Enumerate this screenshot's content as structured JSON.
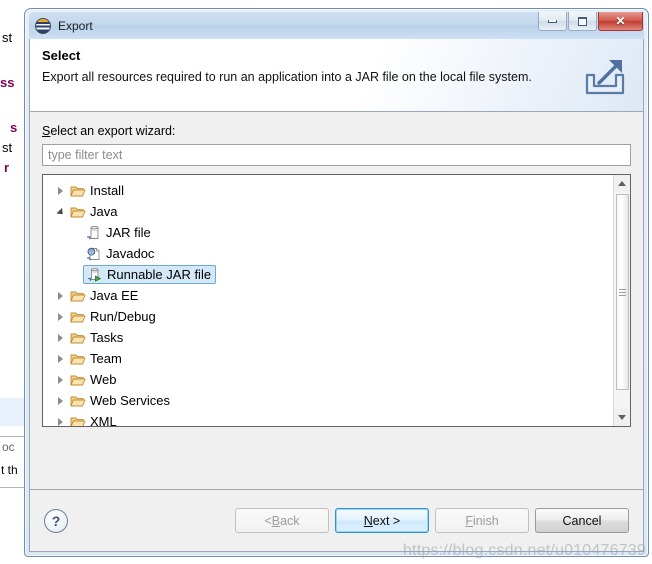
{
  "window": {
    "title": "Export",
    "app_icon": "eclipse-sphere-icon",
    "minimize_label": "Minimize",
    "maximize_label": "Maximize",
    "close_label": "Close",
    "close_glyph": "✕"
  },
  "banner": {
    "title": "Select",
    "description": "Export all resources required to run an application into a JAR file on the local file system.",
    "icon": "export-arrow-icon"
  },
  "content": {
    "tree_label_prefix": "S",
    "tree_label_rest": "elect an export wizard:",
    "filter_placeholder": "type filter text",
    "filter_value": ""
  },
  "tree": {
    "items": [
      {
        "label": "Install",
        "level": 0,
        "state": "collapsed",
        "icon": "folder-icon",
        "selected": false
      },
      {
        "label": "Java",
        "level": 0,
        "state": "expanded",
        "icon": "folder-icon",
        "selected": false
      },
      {
        "label": "JAR file",
        "level": 1,
        "state": "leaf",
        "icon": "jar-file-icon",
        "selected": false
      },
      {
        "label": "Javadoc",
        "level": 1,
        "state": "leaf",
        "icon": "javadoc-icon",
        "selected": false
      },
      {
        "label": "Runnable JAR file",
        "level": 1,
        "state": "leaf",
        "icon": "runnable-jar-icon",
        "selected": true
      },
      {
        "label": "Java EE",
        "level": 0,
        "state": "collapsed",
        "icon": "folder-icon",
        "selected": false
      },
      {
        "label": "Run/Debug",
        "level": 0,
        "state": "collapsed",
        "icon": "folder-icon",
        "selected": false
      },
      {
        "label": "Tasks",
        "level": 0,
        "state": "collapsed",
        "icon": "folder-icon",
        "selected": false
      },
      {
        "label": "Team",
        "level": 0,
        "state": "collapsed",
        "icon": "folder-icon",
        "selected": false
      },
      {
        "label": "Web",
        "level": 0,
        "state": "collapsed",
        "icon": "folder-icon",
        "selected": false
      },
      {
        "label": "Web Services",
        "level": 0,
        "state": "collapsed",
        "icon": "folder-icon",
        "selected": false
      },
      {
        "label": "XML",
        "level": 0,
        "state": "collapsed",
        "icon": "folder-icon",
        "selected": false
      }
    ]
  },
  "buttons": {
    "help": "?",
    "back_prefix": "< ",
    "back_mnemonic": "B",
    "back_rest": "ack",
    "next_prefix": "",
    "next_mnemonic": "N",
    "next_rest": "ext >",
    "finish_prefix": "",
    "finish_mnemonic": "F",
    "finish_rest": "inish",
    "cancel": "Cancel"
  },
  "background": {
    "frag1": "st",
    "frag2": "ss",
    "frag3": "s",
    "frag4": "st",
    "frag5": "r",
    "frag6": "oc",
    "frag7": "t th"
  },
  "watermark": "https://blog.csdn.net/u010476739",
  "colors": {
    "selection_fill": "#d4e9f7",
    "selection_border": "#6fa8d4",
    "default_button_border": "#2f93d4",
    "title_gradient_top": "#cfe0f2",
    "close_button": "#bf3f31",
    "folder_icon": "#f0b860",
    "dialog_bg": "#f0f0f0"
  }
}
